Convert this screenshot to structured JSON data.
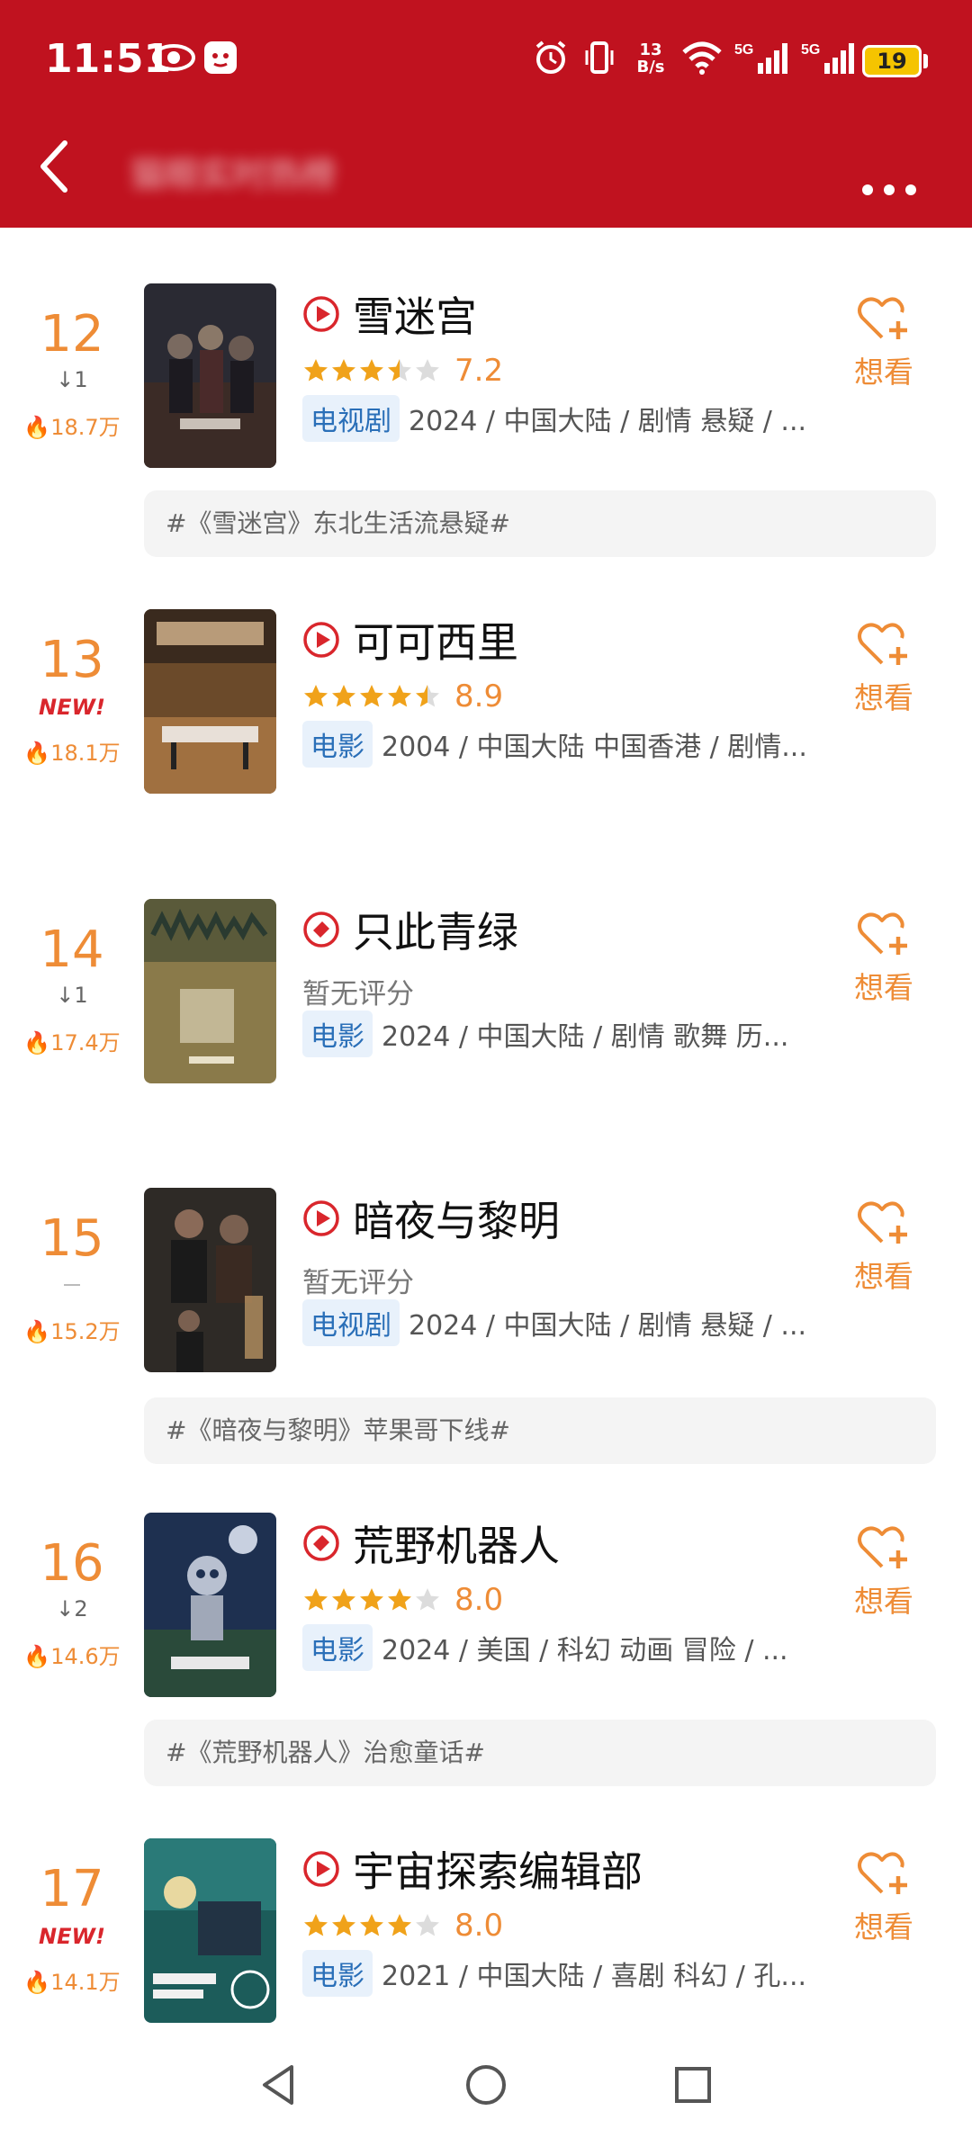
{
  "status_bar": {
    "time": "11:51",
    "net_speed_value": "13",
    "net_speed_unit": "B/s",
    "battery": "19"
  },
  "header": {
    "title": "猫眼实时热榜"
  },
  "colors": {
    "header_red": "#c0121f",
    "accent_orange": "#ee8c36",
    "star_gold": "#f0a21a",
    "tag_blue": "#2a6fb8"
  },
  "items": [
    {
      "rank": "12",
      "change": "↓1",
      "heat": "18.7万",
      "title": "雪迷宫",
      "icon": "play-icon",
      "score": "7.2",
      "stars": [
        1,
        1,
        1,
        0.5,
        0
      ],
      "type": "电视剧",
      "meta": "2024 / 中国大陆 / 剧情 悬疑 / ...",
      "want": "想看",
      "topic": "#《雪迷宫》东北生活流悬疑#"
    },
    {
      "rank": "13",
      "change": "NEW!",
      "heat": "18.1万",
      "title": "可可西里",
      "icon": "play-icon",
      "score": "8.9",
      "stars": [
        1,
        1,
        1,
        1,
        0.5
      ],
      "type": "电影",
      "meta": "2004 / 中国大陆 中国香港 / 剧情...",
      "want": "想看"
    },
    {
      "rank": "14",
      "change": "↓1",
      "heat": "17.4万",
      "title": "只此青绿",
      "icon": "ticket-icon",
      "no_rating": "暂无评分",
      "type": "电影",
      "meta": "2024 / 中国大陆 / 剧情 歌舞 历...",
      "want": "想看"
    },
    {
      "rank": "15",
      "change": "",
      "heat": "15.2万",
      "title": "暗夜与黎明",
      "icon": "play-icon",
      "no_rating": "暂无评分",
      "type": "电视剧",
      "meta": "2024 / 中国大陆 / 剧情 悬疑 / ...",
      "want": "想看",
      "topic": "#《暗夜与黎明》苹果哥下线#"
    },
    {
      "rank": "16",
      "change": "↓2",
      "heat": "14.6万",
      "title": "荒野机器人",
      "icon": "ticket-icon",
      "score": "8.0",
      "stars": [
        1,
        1,
        1,
        1,
        0
      ],
      "type": "电影",
      "meta": "2024 / 美国 / 科幻 动画 冒险 / ...",
      "want": "想看",
      "topic": "#《荒野机器人》治愈童话#"
    },
    {
      "rank": "17",
      "change": "NEW!",
      "heat": "14.1万",
      "title": "宇宙探索编辑部",
      "icon": "play-icon",
      "score": "8.0",
      "stars": [
        1,
        1,
        1,
        1,
        0
      ],
      "type": "电影",
      "meta": "2021 / 中国大陆 / 喜剧 科幻 / 孔...",
      "want": "想看"
    }
  ]
}
